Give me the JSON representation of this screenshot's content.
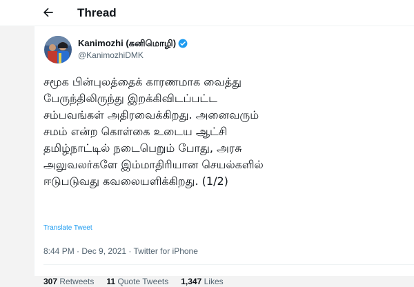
{
  "header": {
    "title": "Thread",
    "back_icon": "arrow-left-icon"
  },
  "tweet": {
    "author_name": "Kanimozhi (கனிமொழி)",
    "author_handle": "@KanimozhiDMK",
    "verified_icon": "verified-badge-icon",
    "text": "சமூக பின்புலத்தைக் காரணமாக வைத்து\nபேருந்திலிருந்து இறக்கிவிடப்பட்ட\nசம்பவங்கள் அதிரவைக்கிறது. அனைவரும்\nசமம் என்ற கொள்கை உடைய ஆட்சி\nதமிழ்நாட்டில் நடைபெறும் போது, அரசு\nஅலுவலர்களே இம்மாதிரியான செயல்களில்\nஈடுபடுவது கவலையளிக்கிறது. (1/2)",
    "translate_label": "Translate Tweet",
    "meta": "8:44 PM · Dec 9, 2021 · Twitter for iPhone",
    "stats": {
      "retweets_count": "307",
      "retweets_label": "Retweets",
      "quote_count": "11",
      "quote_label": "Quote Tweets",
      "likes_count": "1,347",
      "likes_label": "Likes"
    }
  },
  "colors": {
    "link": "#1d9bf0",
    "secondary_text": "#536471",
    "primary_text": "#0f1419",
    "background": "#f3f3f3"
  }
}
